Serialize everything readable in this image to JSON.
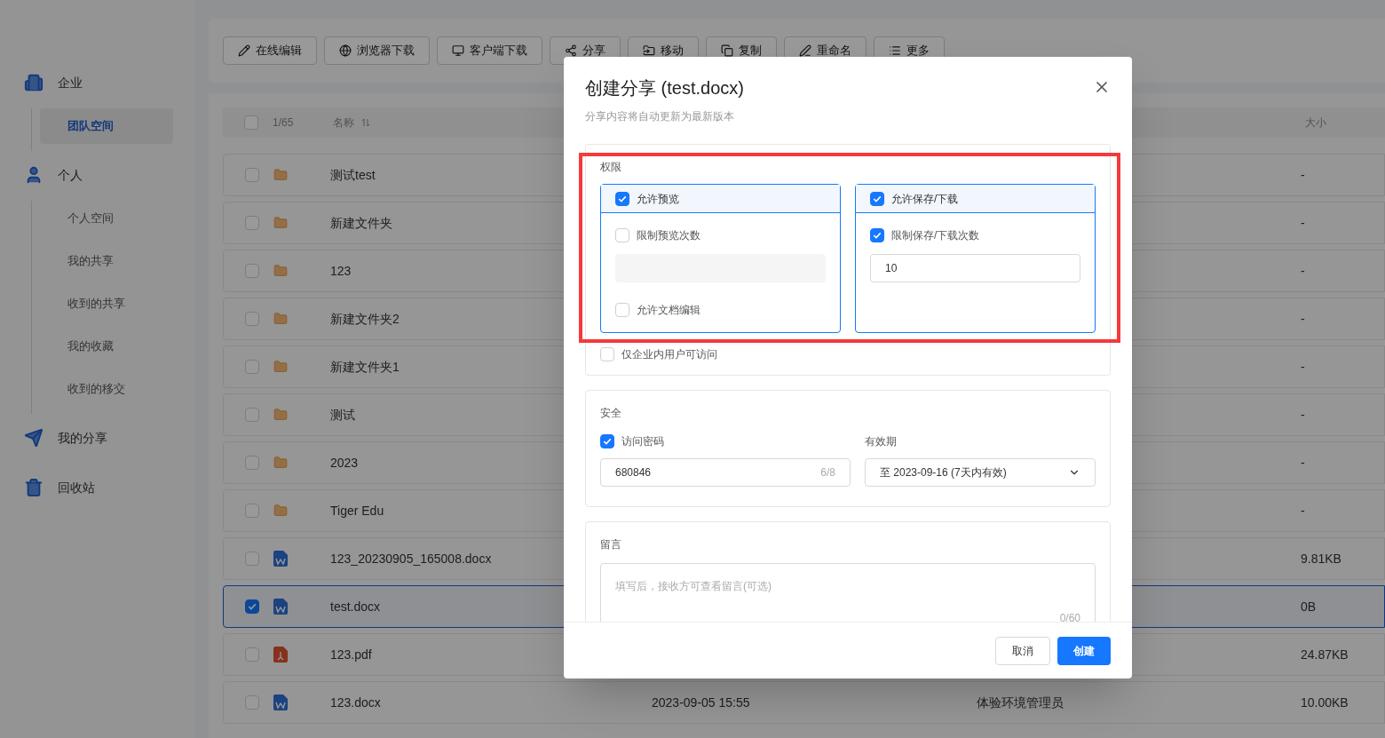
{
  "sidebar": {
    "sections": [
      {
        "label": "企业",
        "children": [
          {
            "label": "团队空间",
            "selected": true
          }
        ]
      },
      {
        "label": "个人",
        "children": [
          {
            "label": "个人空间",
            "selected": false
          },
          {
            "label": "我的共享",
            "selected": false
          },
          {
            "label": "收到的共享",
            "selected": false
          },
          {
            "label": "我的收藏",
            "selected": false
          },
          {
            "label": "收到的移交",
            "selected": false
          }
        ]
      },
      {
        "label": "我的分享"
      },
      {
        "label": "回收站"
      }
    ]
  },
  "toolbar": {
    "buttons": [
      {
        "label": "在线编辑"
      },
      {
        "label": "浏览器下载"
      },
      {
        "label": "客户端下载"
      },
      {
        "label": "分享"
      },
      {
        "label": "移动"
      },
      {
        "label": "复制"
      },
      {
        "label": "重命名"
      },
      {
        "label": "更多"
      }
    ]
  },
  "table": {
    "header": {
      "checked": false,
      "count": "1/65",
      "name": "名称",
      "size": "大小"
    },
    "rows": [
      {
        "name": "测试test",
        "kind": "folder",
        "selected": false,
        "size": "-"
      },
      {
        "name": "新建文件夹",
        "kind": "folder",
        "selected": false,
        "size": "-"
      },
      {
        "name": "123",
        "kind": "folder",
        "selected": false,
        "size": "-"
      },
      {
        "name": "新建文件夹2",
        "kind": "folder",
        "selected": false,
        "size": "-"
      },
      {
        "name": "新建文件夹1",
        "kind": "folder",
        "selected": false,
        "size": "-"
      },
      {
        "name": "测试",
        "kind": "folder",
        "selected": false,
        "size": "-"
      },
      {
        "name": "2023",
        "kind": "folder",
        "selected": false,
        "size": "-"
      },
      {
        "name": "Tiger Edu",
        "kind": "folder",
        "selected": false,
        "size": "-"
      },
      {
        "name": "123_20230905_165008.docx",
        "kind": "word",
        "selected": false,
        "size": "9.81KB"
      },
      {
        "name": "test.docx",
        "kind": "word",
        "selected": true,
        "size": "0B"
      },
      {
        "name": "123.pdf",
        "kind": "pdf",
        "selected": false,
        "size": "24.87KB"
      },
      {
        "name": "123.docx",
        "kind": "word",
        "selected": false,
        "date": "2023-09-05 15:55",
        "owner": "体验环境管理员",
        "size": "10.00KB"
      }
    ]
  },
  "dialog": {
    "title": "创建分享 (test.docx)",
    "subtitle": "分享内容将自动更新为最新版本",
    "permissions": {
      "heading": "权限",
      "preview": {
        "label": "允许预览",
        "checked": true,
        "limit": {
          "label": "限制预览次数",
          "checked": false
        },
        "edit": {
          "label": "允许文档编辑",
          "checked": false
        }
      },
      "download": {
        "label": "允许保存/下载",
        "checked": true,
        "limit": {
          "label": "限制保存/下载次数",
          "checked": true,
          "value": "10"
        }
      },
      "internal_only": {
        "label": "仅企业内用户可访问",
        "checked": false
      }
    },
    "security": {
      "heading": "安全",
      "password": {
        "label": "访问密码",
        "checked": true,
        "value": "680846",
        "counter": "6/8"
      },
      "expiry": {
        "label": "有效期",
        "value": "至 2023-09-16 (7天内有效)"
      }
    },
    "message": {
      "heading": "留言",
      "placeholder": "填写后，接收方可查看留言(可选)",
      "counter": "0/60"
    },
    "cancel": "取消",
    "create": "创建"
  }
}
